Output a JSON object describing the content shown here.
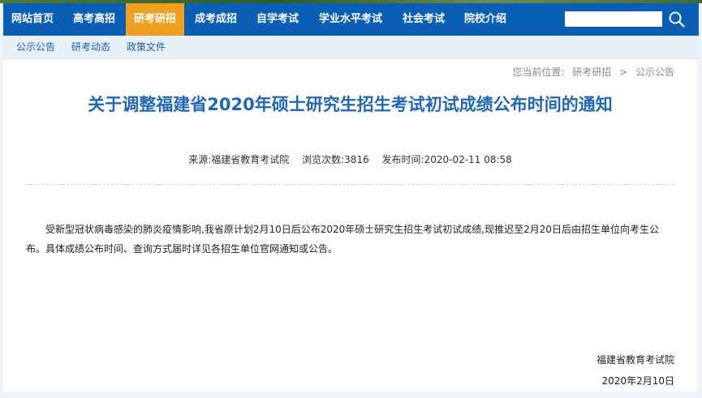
{
  "nav": {
    "items": [
      {
        "label": "网站首页"
      },
      {
        "label": "高考高招"
      },
      {
        "label": "研考研招"
      },
      {
        "label": "成考成招"
      },
      {
        "label": "自学考试"
      },
      {
        "label": "学业水平考试"
      },
      {
        "label": "社会考试"
      },
      {
        "label": "院校介绍"
      }
    ],
    "active": "研考研招",
    "search_placeholder": "",
    "search_icon": "search-icon"
  },
  "subnav": {
    "items": [
      {
        "label": "公示公告"
      },
      {
        "label": "研考动态"
      },
      {
        "label": "政策文件"
      }
    ]
  },
  "breadcrumb": {
    "prefix": "您当前位置:",
    "section": "研考研招",
    "separator": ">",
    "page": "公示公告"
  },
  "article": {
    "title": "关于调整福建省2020年硕士研究生招生考试初试成绩公布时间的通知",
    "source": "来源:福建省教育考试院",
    "views": "浏览次数:3816",
    "published": "发布时间:2020-02-11 08:58",
    "body": "受新型冠状病毒感染的肺炎疫情影响,我省原计划2月10日后公布2020年硕士研究生招生考试初试成绩,现推迟至2月20日后由招生单位向考生公布。具体成绩公布时间、查询方式届时详见各招生单位官网通知或公告。",
    "signature_org": "福建省教育考试院",
    "signature_date": "2020年2月10日"
  },
  "colors": {
    "nav_bg": "#0a5fb4",
    "nav_active": "#f0a020",
    "title": "#1f67b5",
    "link": "#1a5fa8"
  }
}
